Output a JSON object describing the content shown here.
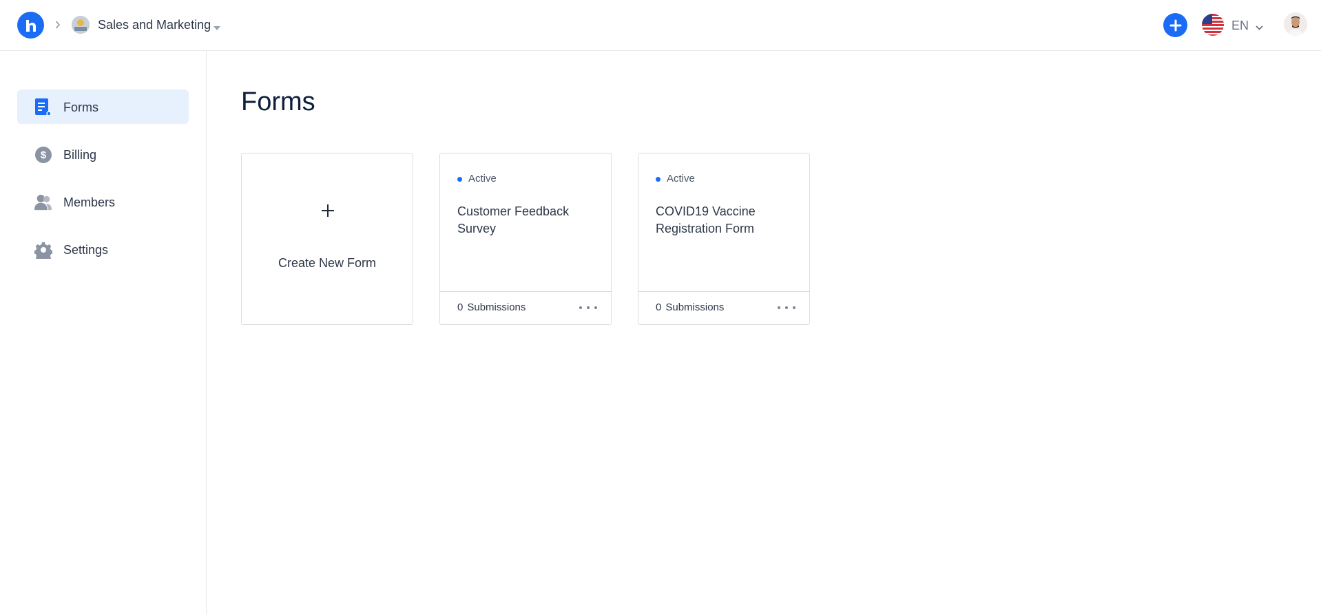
{
  "header": {
    "workspace_name": "Sales and Marketing",
    "language": "EN"
  },
  "sidebar": {
    "items": [
      {
        "label": "Forms",
        "icon": "forms-icon",
        "active": true
      },
      {
        "label": "Billing",
        "icon": "billing-icon",
        "active": false
      },
      {
        "label": "Members",
        "icon": "members-icon",
        "active": false
      },
      {
        "label": "Settings",
        "icon": "gear-icon",
        "active": false
      }
    ]
  },
  "main": {
    "title": "Forms",
    "create_label": "Create New Form",
    "forms": [
      {
        "status": "Active",
        "title": "Customer Feedback Survey",
        "submissions_count": "0",
        "submissions_label": "Submissions"
      },
      {
        "status": "Active",
        "title": "COVID19 Vaccine Registration Form",
        "submissions_count": "0",
        "submissions_label": "Submissions"
      }
    ]
  },
  "colors": {
    "accent": "#1a6cf5",
    "active_nav_bg": "#e7f0fd",
    "title_text": "#0f1e3c"
  }
}
